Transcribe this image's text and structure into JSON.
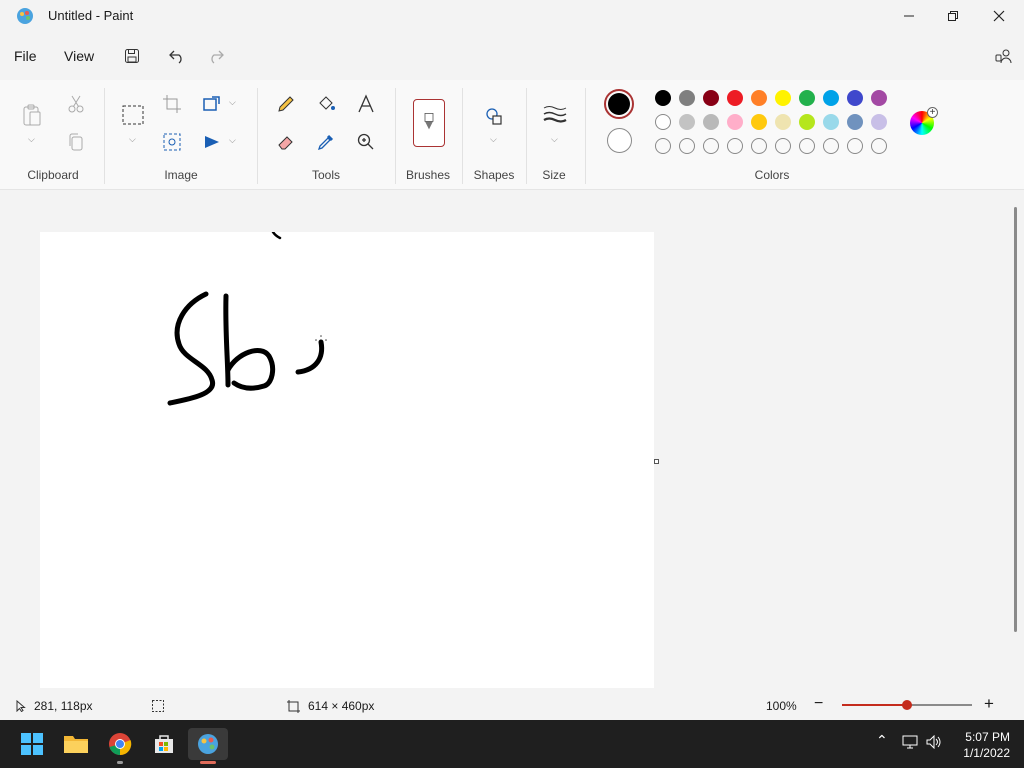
{
  "window": {
    "title": "Untitled - Paint"
  },
  "menu": {
    "file": "File",
    "view": "View"
  },
  "ribbon": {
    "groups": {
      "clipboard": "Clipboard",
      "image": "Image",
      "tools": "Tools",
      "brushes": "Brushes",
      "shapes": "Shapes",
      "size": "Size",
      "colors": "Colors"
    },
    "primary_color": "#000000",
    "secondary_color": "#ffffff",
    "palette_row1": [
      "#000000",
      "#7f7f7f",
      "#880015",
      "#ed1c24",
      "#ff7f27",
      "#fff200",
      "#22b14c",
      "#00a2e8",
      "#3f48cc",
      "#a349a4"
    ],
    "palette_row2": [
      "#ffffff",
      "#c3c3c3",
      "#b9b9b9",
      "#ffaec9",
      "#ffc90e",
      "#efe4b0",
      "#b5e61d",
      "#99d9ea",
      "#7092be",
      "#c8bfe7"
    ],
    "palette_row3_count": 10
  },
  "status": {
    "cursor_position": "281, 118px",
    "canvas_size": "614 × 460px",
    "zoom": "100%",
    "zoom_level": 0.5
  },
  "taskbar": {
    "time": "5:07 PM",
    "date": "1/1/2022"
  }
}
